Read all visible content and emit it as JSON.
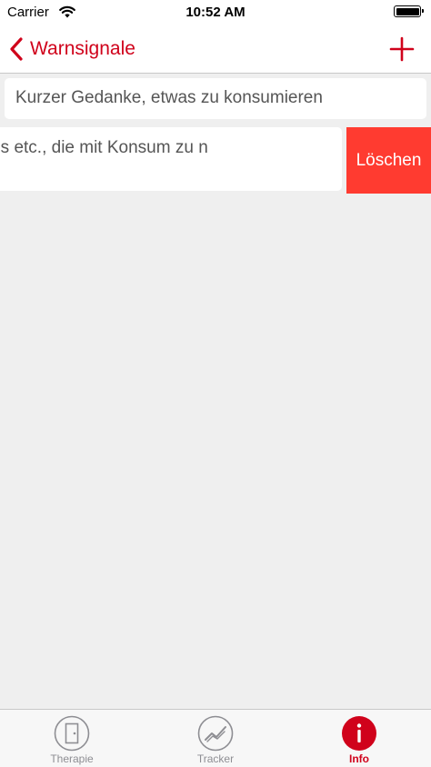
{
  "status_bar": {
    "carrier": "Carrier",
    "time": "10:52 AM"
  },
  "nav": {
    "back_label": "Warnsignale",
    "accent_color": "#d0021b"
  },
  "list": {
    "items": [
      {
        "text": "Kurzer Gedanke, etwas zu konsumieren"
      },
      {
        "text": "ue Videos etc., die mit Konsum zu n"
      }
    ],
    "delete_label": "Löschen",
    "delete_color": "#ff3b30"
  },
  "tab_bar": {
    "tabs": [
      {
        "label": "Therapie",
        "icon": "door-icon"
      },
      {
        "label": "Tracker",
        "icon": "trend-chart-icon"
      },
      {
        "label": "Info",
        "icon": "info-icon"
      }
    ],
    "selected_index": 2
  }
}
